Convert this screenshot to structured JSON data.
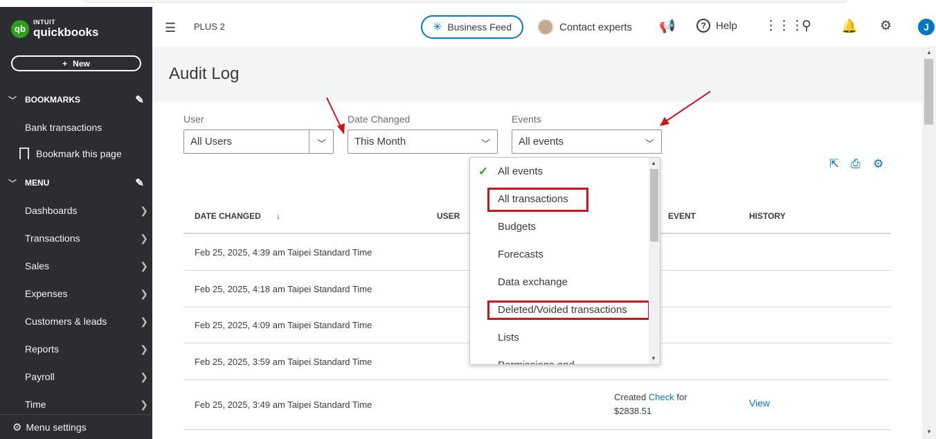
{
  "brand": {
    "intuit": "INTUIT",
    "name": "quickbooks",
    "mark": "qb"
  },
  "sidebar": {
    "new_label": "New",
    "bookmarks_label": "BOOKMARKS",
    "bookmark_items": [
      "Bank transactions"
    ],
    "bookmark_page_label": "Bookmark this page",
    "menu_label": "MENU",
    "menu_items": [
      "Dashboards",
      "Transactions",
      "Sales",
      "Expenses",
      "Customers & leads",
      "Reports",
      "Payroll",
      "Time"
    ],
    "menu_settings_label": "Menu settings"
  },
  "header": {
    "plan": "PLUS 2",
    "business_feed": "Business Feed",
    "contact_experts": "Contact experts",
    "help": "Help",
    "user_initial": "J"
  },
  "page": {
    "title": "Audit Log"
  },
  "filters": {
    "user_label": "User",
    "user_value": "All Users",
    "date_label": "Date Changed",
    "date_value": "This Month",
    "events_label": "Events",
    "events_value": "All events"
  },
  "table": {
    "columns": [
      "DATE CHANGED",
      "USER",
      "EVENT",
      "HISTORY"
    ],
    "sort_indicator": "↓",
    "rows": [
      {
        "date": "Feb 25, 2025, 4:39 am Taipei Standard Time",
        "event_prefix": "",
        "event_link": "",
        "event_suffix": "",
        "event_amount": "",
        "history": ""
      },
      {
        "date": "Feb 25, 2025, 4:18 am Taipei Standard Time",
        "event_prefix": "",
        "event_link": "",
        "event_suffix": "",
        "event_amount": "",
        "history": ""
      },
      {
        "date": "Feb 25, 2025, 4:09 am Taipei Standard Time",
        "event_prefix": "",
        "event_link": "",
        "event_suffix": "",
        "event_amount": "",
        "history": ""
      },
      {
        "date": "Feb 25, 2025, 3:59 am Taipei Standard Time",
        "event_prefix": "",
        "event_link": "",
        "event_suffix": "",
        "event_amount": "",
        "history": ""
      },
      {
        "date": "Feb 25, 2025, 3:49 am Taipei Standard Time",
        "event_prefix": "Created ",
        "event_link": "Check",
        "event_suffix": " for",
        "event_amount": "$2838.51",
        "history": "View"
      }
    ]
  },
  "events_dropdown": {
    "options": [
      "All events",
      "All transactions",
      "Budgets",
      "Forecasts",
      "Data exchange",
      "Deleted/Voided transactions",
      "Lists",
      "Permissions and"
    ],
    "selected": "All events",
    "highlighted": [
      "All transactions",
      "Deleted/Voided transactions"
    ]
  },
  "colors": {
    "accent": "#0077c5",
    "brand_green": "#2ca01c",
    "sidebar_bg": "#2b2d30",
    "annotation_red": "#d0121b"
  }
}
